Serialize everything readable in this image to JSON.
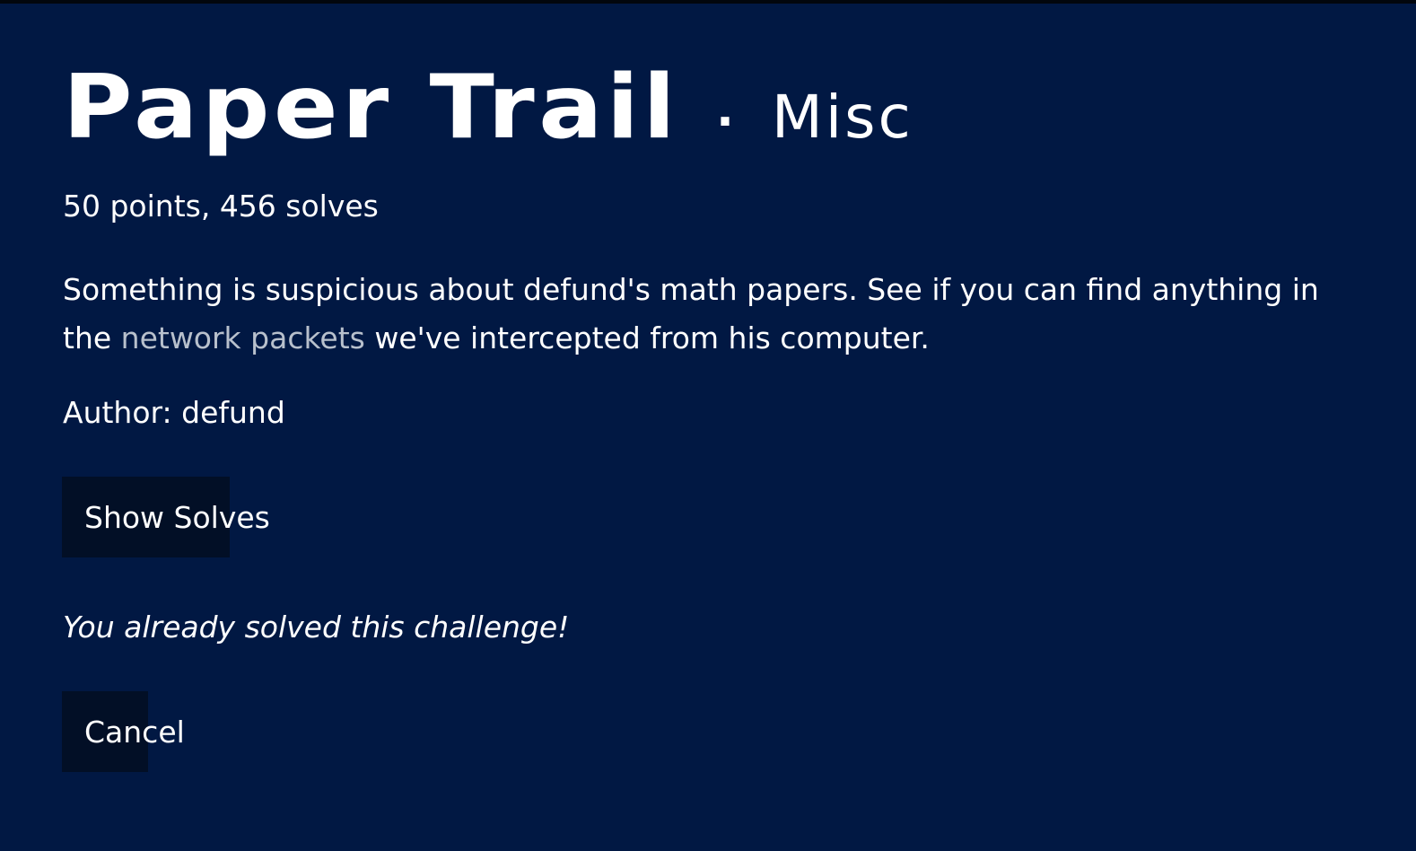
{
  "challenge": {
    "title": "Paper Trail",
    "separator": "·",
    "category": "Misc",
    "stats": "50 points, 456 solves",
    "description_before": "Something is suspicious about defund's math papers. See if you can find anything in the ",
    "description_link": "network packets",
    "description_after": " we've intercepted from his computer.",
    "author": "Author: defund",
    "solved_message": "You already solved this challenge!"
  },
  "buttons": {
    "show_solves": "Show Solves",
    "cancel": "Cancel"
  },
  "colors": {
    "background": "#011843",
    "button_background": "#020f26",
    "link": "#b8c0cc",
    "text": "#ffffff"
  }
}
